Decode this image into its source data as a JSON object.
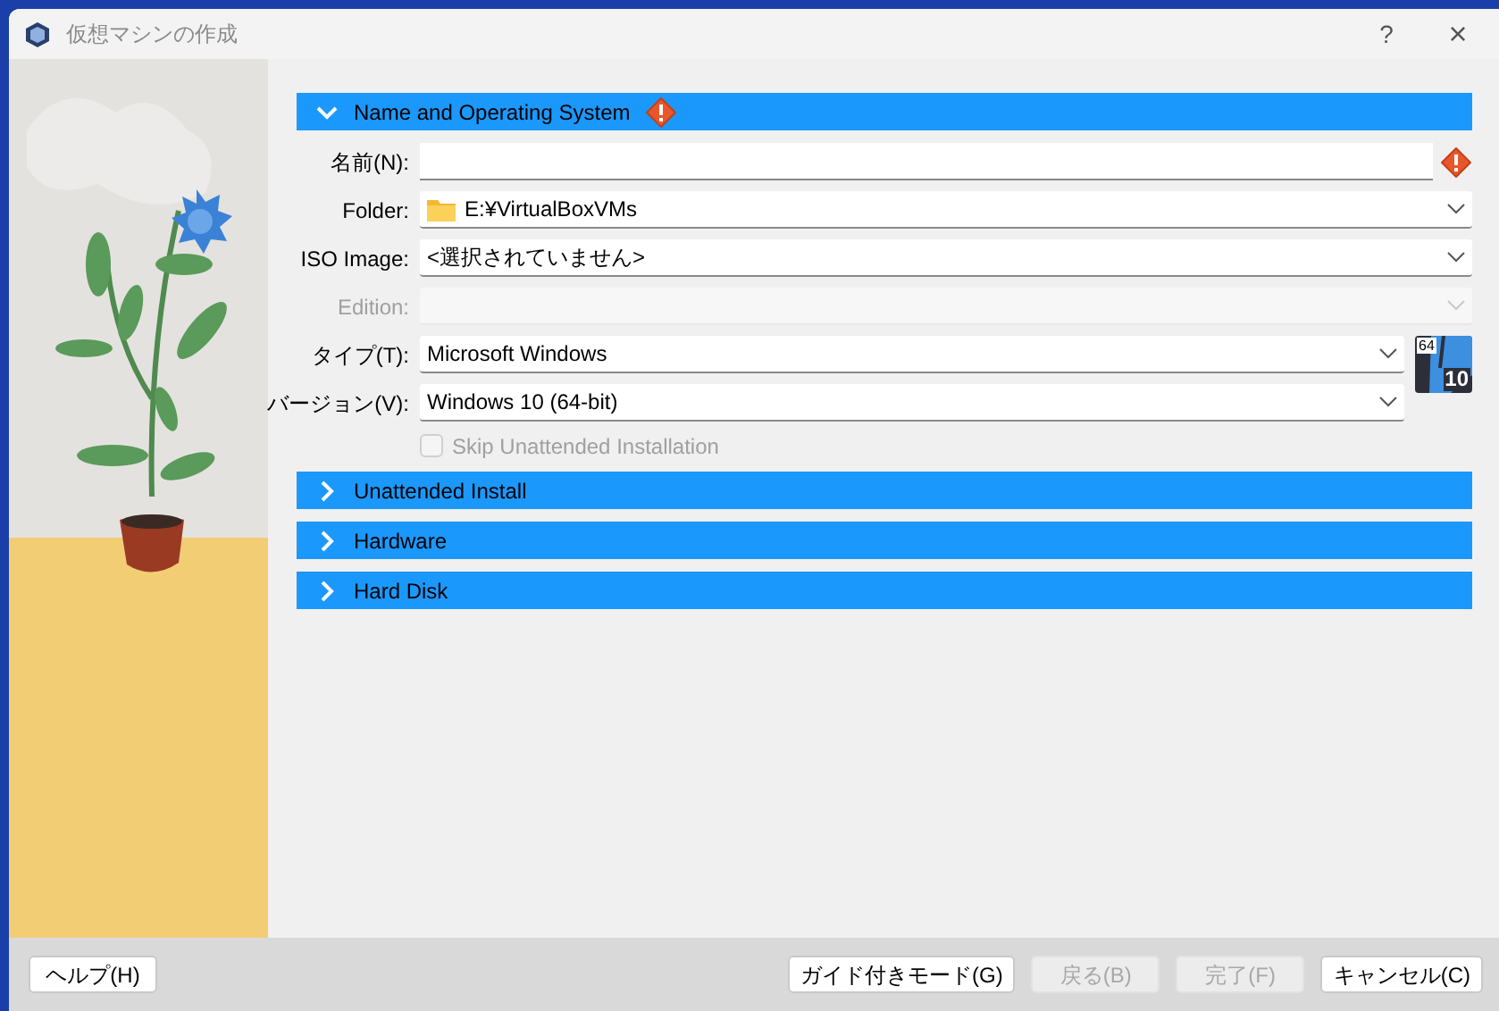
{
  "window": {
    "title": "仮想マシンの作成",
    "help_glyph": "?",
    "close_glyph": "×"
  },
  "sections": [
    {
      "title": "Name and Operating System",
      "expanded": true,
      "warning": true,
      "fields": [
        {
          "kind": "text",
          "label": "名前(N):",
          "warning": true,
          "disabled": false
        },
        {
          "kind": "folder",
          "label": "Folder:",
          "value": "E:¥VirtualBoxVMs",
          "disabled": false
        },
        {
          "kind": "combo",
          "label": "ISO Image:",
          "value": "<選択されていません>",
          "disabled": false
        },
        {
          "kind": "combo",
          "label": "Edition:",
          "disabled": true
        },
        {
          "kind": "os_combo",
          "label": "タイプ(T):",
          "value": "Microsoft Windows",
          "disabled": false
        },
        {
          "kind": "os_combo",
          "label": "バージョン(V):",
          "value": "Windows 10 (64-bit)",
          "disabled": false
        },
        {
          "kind": "checkbox",
          "label": "Skip Unattended Installation",
          "checked": false,
          "disabled": true
        }
      ],
      "os_badge": {
        "bits": "64",
        "version": "10"
      }
    },
    {
      "title": "Unattended Install",
      "expanded": false,
      "warning": false
    },
    {
      "title": "Hardware",
      "expanded": false,
      "warning": false
    },
    {
      "title": "Hard Disk",
      "expanded": false,
      "warning": false
    }
  ],
  "left_buttons": [
    {
      "label": "ヘルプ(H)",
      "disabled": false
    }
  ],
  "right_buttons": [
    {
      "label": "ガイド付きモード(G)",
      "disabled": false
    },
    {
      "label": "戻る(B)",
      "disabled": true
    },
    {
      "label": "完了(F)",
      "disabled": true
    },
    {
      "label": "キャンセル(C)",
      "disabled": false
    }
  ]
}
